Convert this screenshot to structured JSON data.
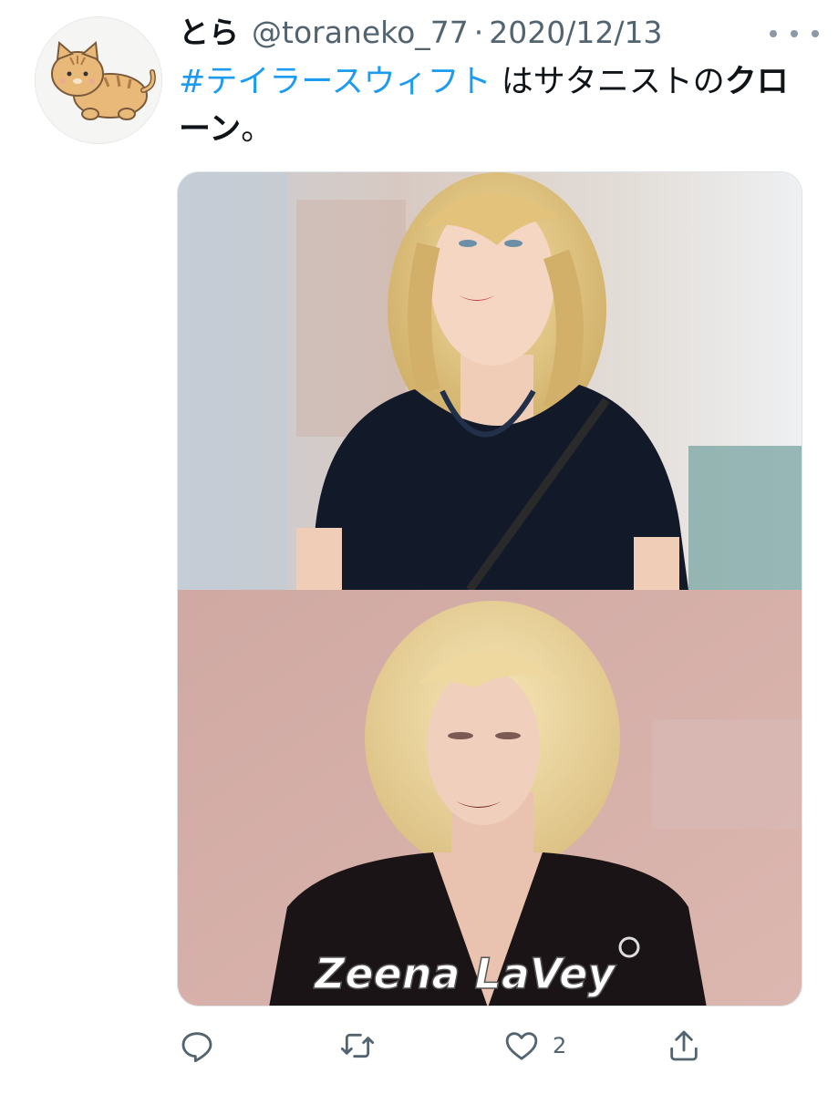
{
  "tweet": {
    "display_name": "とら",
    "handle": "@toraneko_77",
    "separator": "·",
    "date": "2020/12/13",
    "text": {
      "hashtag": "#テイラースウィフト",
      "plain": " はサタニストの",
      "bold": "クローン",
      "end": "。"
    }
  },
  "media": {
    "top_icon": "photo-woman-black-tshirt",
    "bottom_icon": "photo-woman-tv-still",
    "caption": "Zeena LaVey"
  },
  "actions": {
    "reply_icon": "reply-icon",
    "retweet_icon": "retweet-icon",
    "like_icon": "heart-icon",
    "like_count": "2",
    "share_icon": "share-icon"
  },
  "colors": {
    "link": "#1d9bf0",
    "secondary_text": "#536471",
    "primary_text": "#0f1419",
    "icon": "#536471"
  }
}
